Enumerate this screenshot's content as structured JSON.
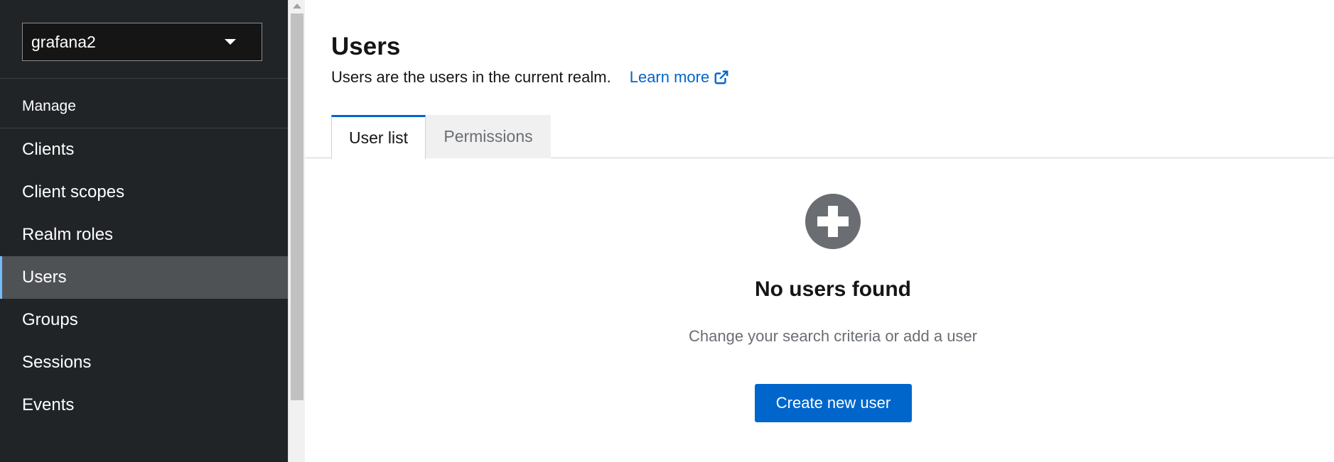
{
  "sidebar": {
    "realm_selector": {
      "value": "grafana2"
    },
    "group_label": "Manage",
    "items": [
      {
        "label": "Clients"
      },
      {
        "label": "Client scopes"
      },
      {
        "label": "Realm roles"
      },
      {
        "label": "Users",
        "active": true
      },
      {
        "label": "Groups"
      },
      {
        "label": "Sessions"
      },
      {
        "label": "Events"
      }
    ]
  },
  "header": {
    "title": "Users",
    "description": "Users are the users in the current realm.",
    "learn_more": "Learn more"
  },
  "tabs": [
    {
      "label": "User list",
      "active": true
    },
    {
      "label": "Permissions",
      "active": false
    }
  ],
  "empty_state": {
    "title": "No users found",
    "body": "Change your search criteria or add a user",
    "action_label": "Create new user"
  },
  "colors": {
    "sidebar_bg": "#212427",
    "active_nav_bg": "#4f5255",
    "primary": "#0066cc",
    "link": "#0066cc",
    "icon_gray": "#6a6e73"
  }
}
